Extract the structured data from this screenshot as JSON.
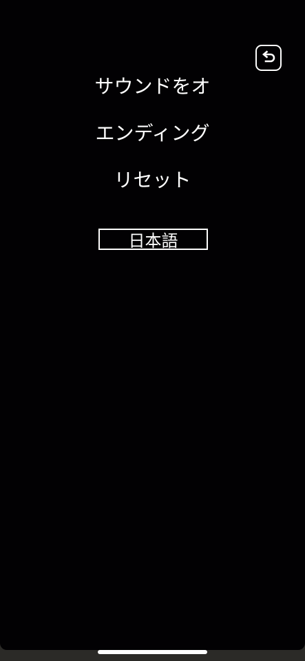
{
  "menu": {
    "back_icon": "undo-arrow-icon",
    "sound_label": "サウンドをオ",
    "ending_label": "エンディング",
    "reset_label": "リセット",
    "language_label": "日本語"
  },
  "colors": {
    "background": "#020103",
    "foreground": "#ffffff",
    "bottom_bar": "#2b2a27"
  }
}
